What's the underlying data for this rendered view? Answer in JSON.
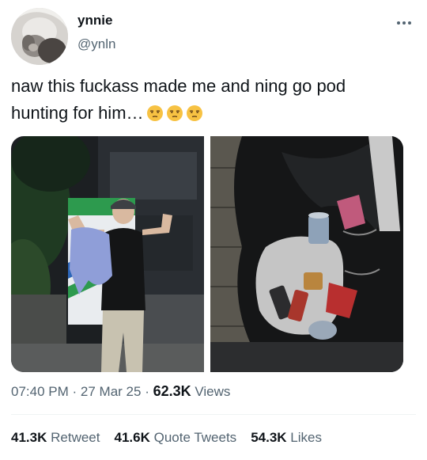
{
  "author": {
    "display_name": "ynnie",
    "handle": "@ynln"
  },
  "tweet": {
    "text": "naw this fuckass made me and ning go pod hunting for him…",
    "emojis": [
      "unamused-face-emoji",
      "unamused-face-emoji",
      "unamused-face-emoji"
    ]
  },
  "meta": {
    "time": "07:40 PM",
    "sep1": "·",
    "date": "27 Mar 25",
    "sep2": "·",
    "views_count": "62.3K",
    "views_label": "Views"
  },
  "stats": {
    "retweets_count": "41.3K",
    "retweets_label": "Retweet",
    "quotes_count": "41.6K",
    "quotes_label": "Quote Tweets",
    "likes_count": "54.3K",
    "likes_label": "Likes"
  },
  "icons": {
    "more": "more-horizontal-icon"
  },
  "colors": {
    "text_primary": "#0f1419",
    "text_secondary": "#536471",
    "divider": "#eff3f4",
    "emoji_face": "#f7c243"
  }
}
